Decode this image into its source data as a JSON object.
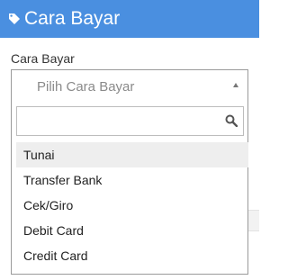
{
  "header": {
    "icon": "tag-icon",
    "title": "Cara Bayar"
  },
  "field": {
    "label": "Cara Bayar",
    "placeholder": "Pilih Cara Bayar",
    "caret_icon": "caret-up-icon"
  },
  "search": {
    "value": "",
    "icon": "search-icon"
  },
  "options": [
    "Tunai",
    "Transfer Bank",
    "Cek/Giro",
    "Debit Card",
    "Credit Card"
  ],
  "highlighted_option": "Tunai",
  "colors": {
    "header_bg": "#4a8fe0",
    "highlight_bg": "#eeeeee"
  }
}
